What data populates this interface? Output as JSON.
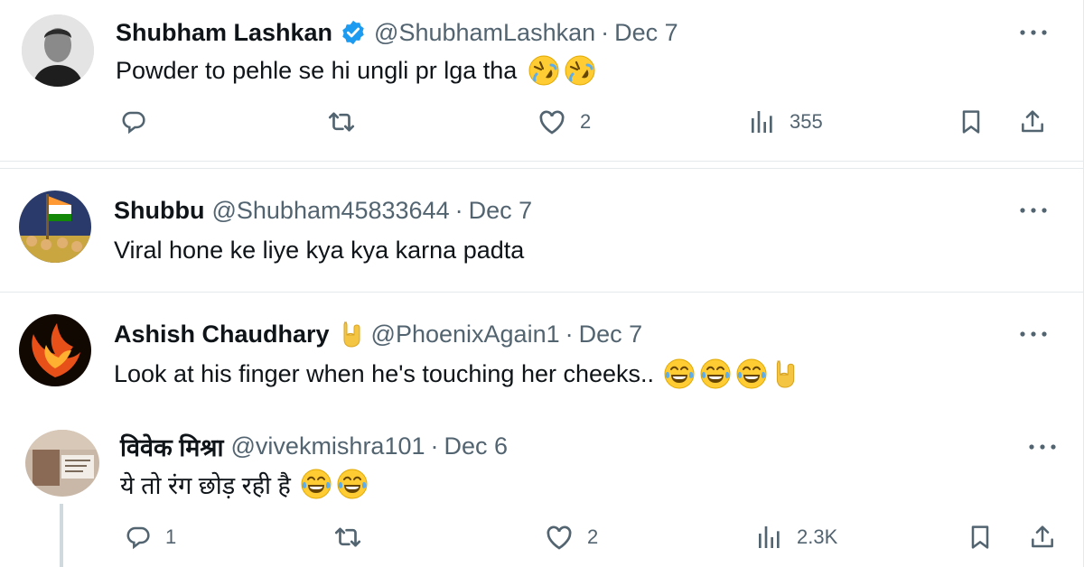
{
  "tweets": [
    {
      "name": "Shubham Lashkan",
      "handle": "@ShubhamLashkan",
      "separator": "·",
      "date": "Dec 7",
      "verified": true,
      "text": "Powder to pehle se hi ungli pr lga tha",
      "emojis": [
        "rolling-on-floor-laughing",
        "rolling-on-floor-laughing"
      ],
      "actions": {
        "replies": "",
        "retweets": "",
        "likes": "2",
        "views": "355"
      }
    },
    {
      "name": "Shubbu",
      "handle": "@Shubham45833644",
      "separator": "·",
      "date": "Dec 7",
      "text": "Viral hone ke liye kya kya karna padta"
    },
    {
      "name": "Ashish Chaudhary",
      "handle": "@PhoenixAgain1",
      "separator": "·",
      "date": "Dec 7",
      "name_badge": "sign-of-the-horns",
      "text": "Look at his finger when he's touching her cheeks..",
      "emojis": [
        "tears-of-joy",
        "tears-of-joy",
        "tears-of-joy",
        "sign-of-the-horns"
      ]
    },
    {
      "name": "विवेक मिश्रा",
      "handle": "@vivekmishra101",
      "separator": "·",
      "date": "Dec 6",
      "text": "ये तो रंग छोड़ रही है",
      "emojis": [
        "tears-of-joy",
        "tears-of-joy"
      ],
      "actions": {
        "replies": "1",
        "retweets": "",
        "likes": "2",
        "views": "2.3K"
      }
    }
  ],
  "icons": {
    "reply": "reply-icon",
    "retweet": "retweet-icon",
    "like": "heart-icon",
    "views": "views-icon",
    "bookmark": "bookmark-icon",
    "share": "share-icon",
    "more": "more-icon",
    "verified": "verified-badge-icon"
  },
  "colors": {
    "text": "#0f1419",
    "secondary": "#536471",
    "verified": "#1d9bf0",
    "divider": "#e6e9eb"
  }
}
